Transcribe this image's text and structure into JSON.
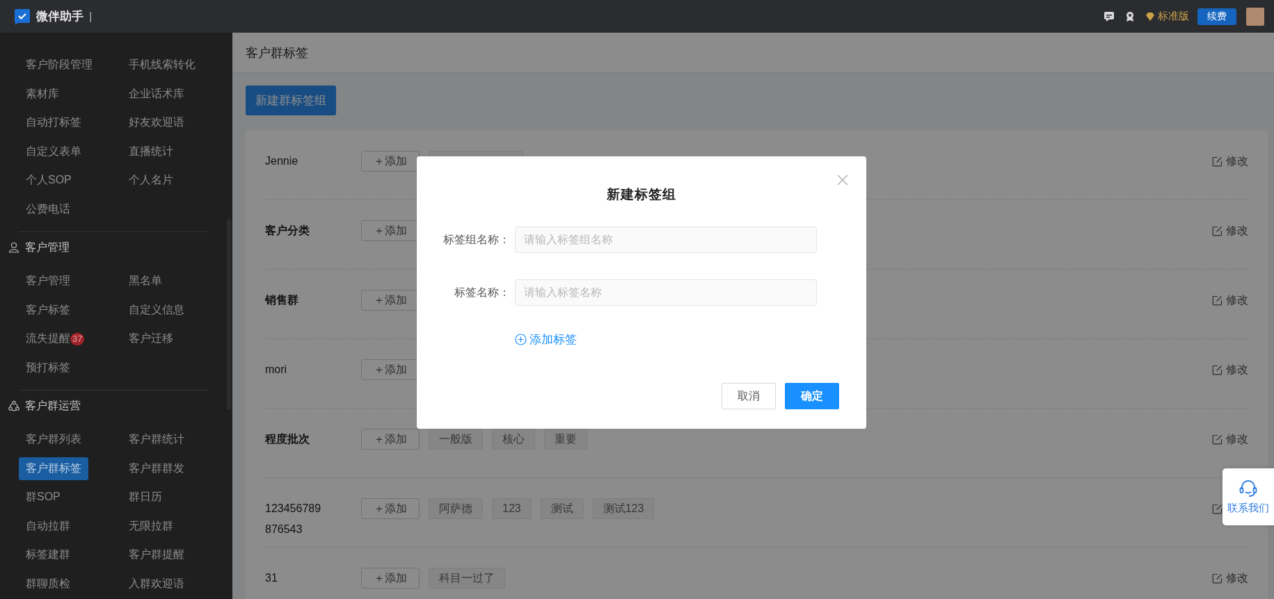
{
  "topbar": {
    "brand": "微伴助手",
    "separator": "|",
    "edition": "标准版",
    "renew_button": "续费"
  },
  "sidebar": {
    "sections": [
      {
        "items": [
          {
            "label": "客户阶段管理",
            "selected": false
          },
          {
            "label": "手机线索转化",
            "selected": false
          },
          {
            "label": "素材库",
            "selected": false
          },
          {
            "label": "企业话术库",
            "selected": false
          },
          {
            "label": "自动打标签",
            "selected": false
          },
          {
            "label": "好友欢迎语",
            "selected": false
          },
          {
            "label": "自定义表单",
            "selected": false
          },
          {
            "label": "直播统计",
            "selected": false
          },
          {
            "label": "个人SOP",
            "selected": false
          },
          {
            "label": "个人名片",
            "selected": false
          },
          {
            "label": "公费电话",
            "selected": false
          }
        ]
      },
      {
        "title": "客户管理",
        "items": [
          {
            "label": "客户管理",
            "selected": false
          },
          {
            "label": "黑名单",
            "selected": false
          },
          {
            "label": "客户标签",
            "selected": false
          },
          {
            "label": "自定义信息",
            "selected": false
          },
          {
            "label": "流失提醒",
            "selected": false,
            "badge": "37"
          },
          {
            "label": "客户迁移",
            "selected": false
          },
          {
            "label": "预打标签",
            "selected": false
          }
        ]
      },
      {
        "title": "客户群运营",
        "items": [
          {
            "label": "客户群列表",
            "selected": false
          },
          {
            "label": "客户群统计",
            "selected": false
          },
          {
            "label": "客户群标签",
            "selected": true
          },
          {
            "label": "客户群群发",
            "selected": false
          },
          {
            "label": "群SOP",
            "selected": false
          },
          {
            "label": "群日历",
            "selected": false
          },
          {
            "label": "自动拉群",
            "selected": false
          },
          {
            "label": "无限拉群",
            "selected": false
          },
          {
            "label": "标签建群",
            "selected": false
          },
          {
            "label": "客户群提醒",
            "selected": false
          },
          {
            "label": "群聊质检",
            "selected": false
          },
          {
            "label": "入群欢迎语",
            "selected": false
          }
        ]
      }
    ]
  },
  "page": {
    "title": "客户群标签",
    "new_button": "新建群标签组",
    "groups": [
      {
        "name": "Jennie",
        "bold": false,
        "add_button": "＋添加",
        "covered_tag": true,
        "edit": "修改"
      },
      {
        "name": "客户分类",
        "bold": true,
        "add_button": "＋添加",
        "edit": "修改"
      },
      {
        "name": "销售群",
        "bold": true,
        "add_button": "＋添加",
        "edit": "修改"
      },
      {
        "name": "mori",
        "bold": false,
        "add_button": "＋添加",
        "edit": "修改"
      },
      {
        "name": "程度批次",
        "bold": true,
        "add_button": "＋添加",
        "tags": [
          "一般版",
          "核心",
          "重要"
        ],
        "edit": "修改"
      },
      {
        "name": "123456789 876543",
        "bold": false,
        "add_button": "＋添加",
        "tags": [
          "阿萨德",
          "123",
          "测试",
          "测试123"
        ]
      },
      {
        "name": "31",
        "bold": false,
        "add_button": "＋添加",
        "tags": [
          "科目一过了"
        ],
        "edit": "修改"
      }
    ]
  },
  "modal": {
    "title": "新建标签组",
    "fields": [
      {
        "label": "标签组名称：",
        "placeholder": "请输入标签组名称"
      },
      {
        "label": "标签名称：",
        "placeholder": "请输入标签名称"
      }
    ],
    "add_link": "添加标签",
    "buttons": [
      {
        "label": "取消",
        "kind": "default"
      },
      {
        "label": "确定",
        "kind": "primary"
      }
    ]
  },
  "contact": {
    "label": "联系我们"
  }
}
